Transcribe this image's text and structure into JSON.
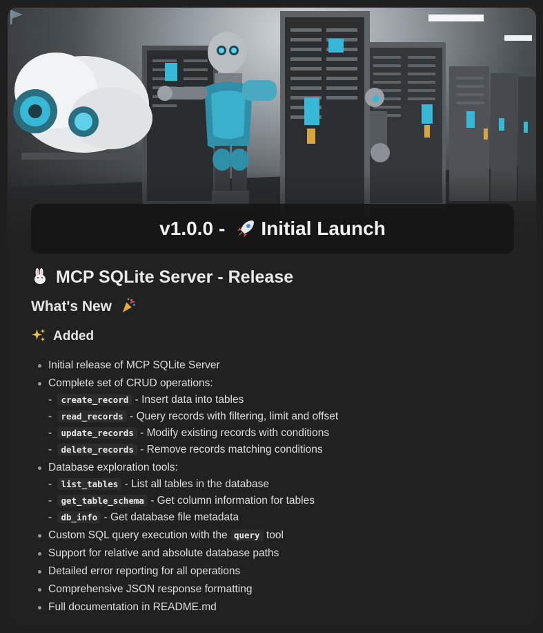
{
  "banner": {
    "version": "v1.0.0",
    "separator": "-",
    "rocket_icon": "rocket-icon",
    "title": "Initial Launch"
  },
  "page": {
    "title": "MCP SQLite Server - Release",
    "title_icon": "rabbit-icon",
    "section": "What's New",
    "section_icon": "party-popper-icon",
    "subsection_icon": "sparkles-icon",
    "subsection": "Added"
  },
  "list": {
    "item1": "Initial release of MCP SQLite Server",
    "item2": "Complete set of CRUD operations:",
    "crud": [
      {
        "code": "create_record",
        "desc": "- Insert data into tables"
      },
      {
        "code": "read_records",
        "desc": "- Query records with filtering, limit and offset"
      },
      {
        "code": "update_records",
        "desc": "- Modify existing records with conditions"
      },
      {
        "code": "delete_records",
        "desc": "- Remove records matching conditions"
      }
    ],
    "item3": "Database exploration tools:",
    "tools": [
      {
        "code": "list_tables",
        "desc": "- List all tables in the database"
      },
      {
        "code": "get_table_schema",
        "desc": "- Get column information for tables"
      },
      {
        "code": "db_info",
        "desc": "- Get database file metadata"
      }
    ],
    "item4_pre": "Custom SQL query execution with the",
    "item4_code": "query",
    "item4_post": "tool",
    "item5": "Support for relative and absolute database paths",
    "item6": "Detailed error reporting for all operations",
    "item7": "Comprehensive JSON response formatting",
    "item8": "Full documentation in README.md"
  },
  "colors": {
    "background": "#1f1f1f",
    "card": "#212121",
    "accent": "#36b8d6",
    "code_bg": "#2c2c2c"
  }
}
